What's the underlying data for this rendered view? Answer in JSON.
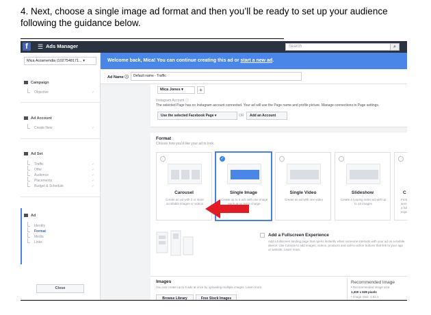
{
  "instruction": {
    "line1": "4.  Next, choose a single image ad format and then you’ll be ready to set up your audience",
    "line2": "following the guidance below."
  },
  "topbar": {
    "logo": "f",
    "menu_icon": "hamburger-icon",
    "title": "Ads Manager",
    "search_placeholder": "Search",
    "search_icon": "search-icon"
  },
  "sidebar": {
    "account": "Mica Arzamendia (1027548171... ▾",
    "campaign": {
      "label": "Campaign",
      "items": [
        "Objective"
      ]
    },
    "ad_account": {
      "label": "Ad Account",
      "items": [
        "Create New"
      ]
    },
    "ad_set": {
      "label": "Ad Set",
      "items": [
        "Traffic",
        "Offer",
        "Audience",
        "Placements",
        "Budget & Schedule"
      ]
    },
    "ad": {
      "label": "Ad",
      "items": [
        "Identity",
        "Format",
        "Media",
        "Links"
      ]
    },
    "close_label": "Close"
  },
  "banner": {
    "text": "Welcome back, Mica! You can continue creating this ad or ",
    "link": "start a new ad",
    "end": "."
  },
  "ad_name": {
    "label": "Ad Name ⓘ",
    "value": "Default name - Traffic"
  },
  "identity": {
    "page": "Mica Jones ▾",
    "plus": "+",
    "ig_label": "Instagram Account ⓘ",
    "ig_desc": "The selected Page has no Instagram account connected. Your ad will use the Page name and profile picture. Manage connections in Page settings.",
    "use_page": "Use the selected Facebook Page ▾",
    "or": "OR",
    "add_account": "Add an Account"
  },
  "format": {
    "title": "Format",
    "subtitle": "Choose how you'd like your ad to look.",
    "cards": [
      {
        "title": "Carousel",
        "desc": "Create an ad with 2 or more scrollable images or videos"
      },
      {
        "title": "Single Image",
        "desc": "Create up to 6 ads with one image each at no extra charge"
      },
      {
        "title": "Single Video",
        "desc": "Create an ad with one video"
      },
      {
        "title": "Slideshow",
        "desc": "Create a looping video ad with up to 10 images"
      },
      {
        "title": "C",
        "desc": "Feature items in a full experien"
      }
    ],
    "fse_title": "Add a Fullscreen Experience",
    "fse_desc": "Add a fullscreen landing page that opens instantly when someone interacts with your ad on a mobile device. Use Canvas to add images, videos, products and call-to-action buttons that link to your app or website. Learn more."
  },
  "images": {
    "title": "Images",
    "desc": "You can create up to 6 ads at once by uploading multiple images. Learn more.",
    "browse": "Browse Library",
    "free": "Free Stock Images",
    "rec_title": "Recommended Image",
    "rec_size_label": "• Recommended image size:",
    "rec_size": "1,200 x 628 pixels",
    "rec_ratio": "• Image ratio: 1.91:1"
  }
}
